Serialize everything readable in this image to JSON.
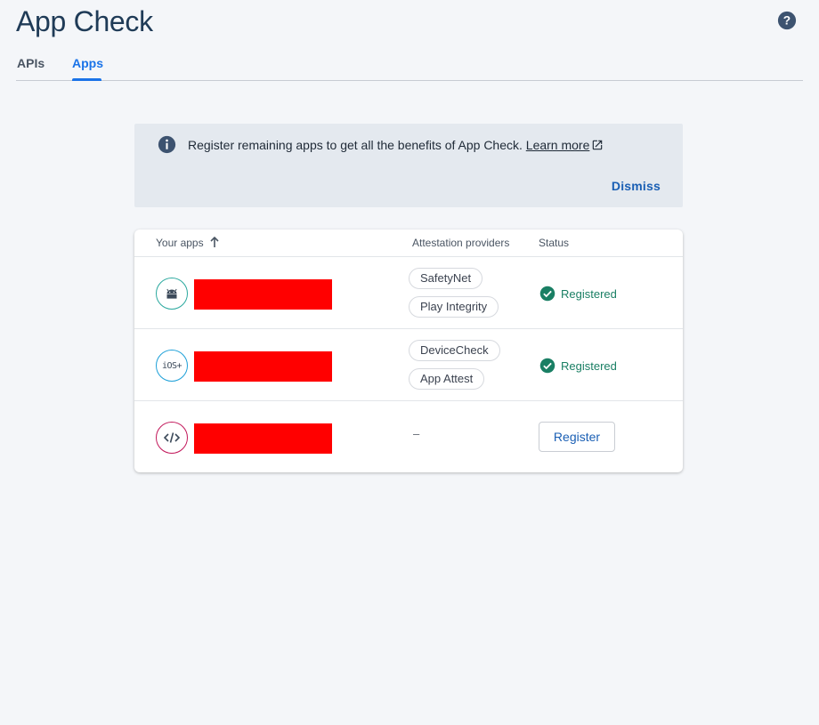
{
  "header": {
    "title": "App Check",
    "help_icon": "help-circle-icon"
  },
  "tabs": [
    {
      "label": "APIs",
      "active": false
    },
    {
      "label": "Apps",
      "active": true
    }
  ],
  "banner": {
    "icon": "info-icon",
    "message": "Register remaining apps to get all the benefits of App Check.",
    "link_label": "Learn more",
    "link_icon": "external-link-icon",
    "dismiss_label": "Dismiss"
  },
  "table": {
    "columns": {
      "apps": "Your apps",
      "attestation": "Attestation providers",
      "status": "Status"
    },
    "sort_icon": "arrow-up-icon",
    "rows": [
      {
        "platform": "android",
        "icon": "android-icon",
        "name_redacted": true,
        "providers": [
          "SafetyNet",
          "Play Integrity"
        ],
        "status": "Registered"
      },
      {
        "platform": "ios",
        "icon": "ios-icon",
        "icon_text": "iOS+",
        "name_redacted": true,
        "providers": [
          "DeviceCheck",
          "App Attest"
        ],
        "status": "Registered"
      },
      {
        "platform": "web",
        "icon": "code-icon",
        "name_redacted": true,
        "providers_placeholder": "–",
        "action_label": "Register"
      }
    ]
  },
  "colors": {
    "accent": "#1a73e8",
    "registered": "#1a7f64",
    "banner_bg": "#e4e9ef",
    "redaction": "#ff0000"
  }
}
